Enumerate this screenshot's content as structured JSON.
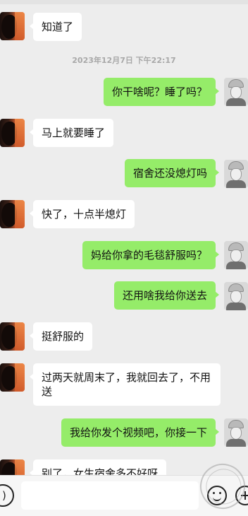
{
  "messages": [
    {
      "side": "left",
      "text": "知道了"
    },
    {
      "type": "timestamp",
      "text": "2023年12月7日 下午22:17"
    },
    {
      "side": "right",
      "text": "你干啥呢？睡了吗？"
    },
    {
      "side": "left",
      "text": "马上就要睡了"
    },
    {
      "side": "right",
      "text": "宿舍还没熄灯吗"
    },
    {
      "side": "left",
      "text": "快了，十点半熄灯"
    },
    {
      "side": "right",
      "text": "妈给你拿的毛毯舒服吗？"
    },
    {
      "side": "right",
      "text": "还用啥我给你送去"
    },
    {
      "side": "left",
      "text": "挺舒服的"
    },
    {
      "side": "left",
      "text": "过两天就周末了，我就回去了，不用送"
    },
    {
      "side": "right",
      "text": "我给你发个视频吧，你接一下"
    },
    {
      "side": "left",
      "text": "别了，女生宿舍多不好呀"
    }
  ],
  "icons": {
    "voice": "voice-icon",
    "emoji": "emoji-icon",
    "plus": "plus-icon"
  },
  "colors": {
    "background": "#ededed",
    "bubble_self": "#95ec69",
    "bubble_other": "#ffffff",
    "timestamp_text": "#a8a8a8"
  }
}
